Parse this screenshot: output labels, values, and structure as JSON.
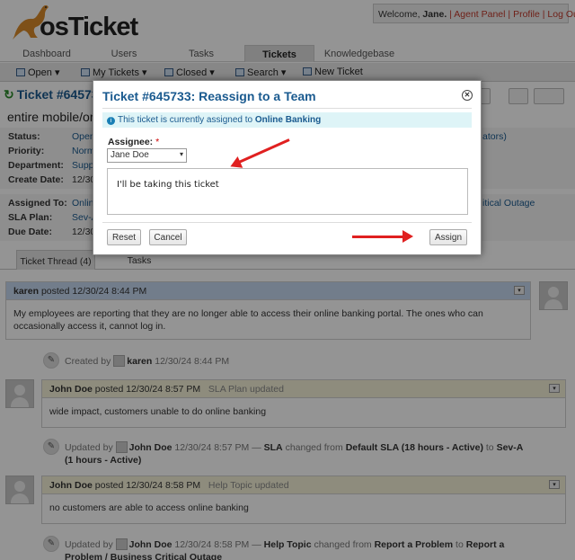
{
  "header": {
    "logo_text": "osTicket",
    "welcome_prefix": "Welcome, ",
    "welcome_name": "Jane.",
    "links": [
      "Agent Panel",
      "Profile",
      "Log Out"
    ]
  },
  "nav": {
    "tabs": [
      "Dashboard",
      "Users",
      "Tasks",
      "Tickets",
      "Knowledgebase"
    ],
    "active": "Tickets"
  },
  "subnav": [
    "Open",
    "My Tickets",
    "Closed",
    "Search",
    "New Ticket"
  ],
  "ticket": {
    "number_label": "Ticket #645733",
    "subject": "entire mobile/on",
    "fields_left": [
      {
        "label": "Status:",
        "value": "Open"
      },
      {
        "label": "Priority:",
        "value": "Norm"
      },
      {
        "label": "Department:",
        "value": "Supp"
      },
      {
        "label": "Create Date:",
        "value": "12/30"
      }
    ],
    "fields_left2": [
      {
        "label": "Assigned To:",
        "value": "Onlin"
      },
      {
        "label": "SLA Plan:",
        "value": "Sev-A"
      },
      {
        "label": "Due Date:",
        "value": "12/30"
      }
    ],
    "right_values": [
      "ators)",
      "itical Outage"
    ]
  },
  "thread_tabs": [
    "Ticket Thread (4)",
    "Tasks"
  ],
  "thread": {
    "entry1": {
      "author": "karen",
      "posted": "posted 12/30/24 8:44 PM",
      "body": "My employees are reporting that they are no longer able to access their online banking portal. The ones who can occasionally access it, cannot log in."
    },
    "event1": {
      "prefix": "Created by",
      "user": "karen",
      "time": "12/30/24 8:44 PM"
    },
    "entry2": {
      "author": "John Doe",
      "posted": "posted 12/30/24 8:57 PM",
      "title": "SLA Plan updated",
      "body": "wide impact, customers unable to do online banking"
    },
    "event2": {
      "prefix": "Updated by",
      "user": "John Doe",
      "time": "12/30/24 8:57 PM —",
      "field": "SLA",
      "mid": "changed from",
      "from": "Default SLA (18 hours - Active)",
      "to_word": "to",
      "to": "Sev-A (1 hours - Active)"
    },
    "entry3": {
      "author": "John Doe",
      "posted": "posted 12/30/24 8:58 PM",
      "title": "Help Topic updated",
      "body": "no customers are able to access online banking"
    },
    "event3": {
      "prefix": "Updated by",
      "user": "John Doe",
      "time": "12/30/24 8:58 PM —",
      "field": "Help Topic",
      "mid": "changed from",
      "from": "Report a Problem",
      "to_word": "to",
      "to": "Report a Problem / Business Critical Outage"
    }
  },
  "modal": {
    "title": "Ticket #645733: Reassign to a Team",
    "close_icon": "close-icon",
    "notice_prefix": "This ticket is currently assigned to",
    "notice_team": "Online Banking",
    "assignee_label": "Assignee:",
    "required_mark": "*",
    "assignee_value": "Jane Doe",
    "comment_value": "I'll be taking this ticket",
    "reset_label": "Reset",
    "cancel_label": "Cancel",
    "assign_label": "Assign"
  },
  "colors": {
    "accent": "#1a5a8f",
    "arrow": "#e02020",
    "link_red": "#c0392b"
  }
}
